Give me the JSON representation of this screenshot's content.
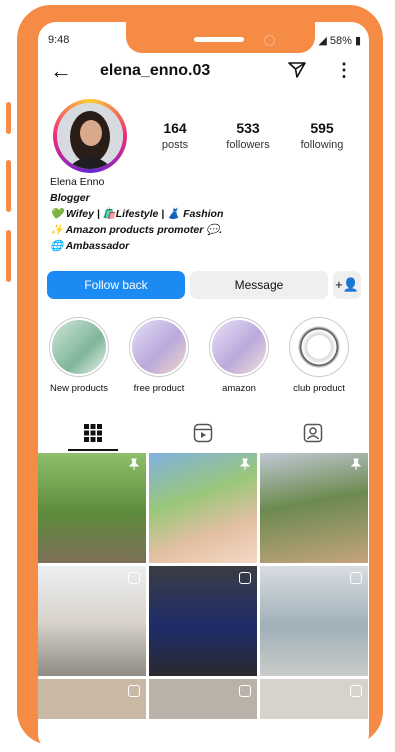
{
  "status_bar": {
    "time": "9:48",
    "battery": "58%"
  },
  "header": {
    "username": "elena_enno.03"
  },
  "profile": {
    "stats": [
      {
        "value": "164",
        "label": "posts"
      },
      {
        "value": "533",
        "label": "followers"
      },
      {
        "value": "595",
        "label": "following"
      }
    ],
    "name": "Elena Enno",
    "category": "Blogger",
    "bio_lines": [
      "💚 Wifey | 🛍️Lifestyle | 👗 Fashion",
      "✨ Amazon products promoter 💬.",
      "🌐 Ambassador"
    ]
  },
  "actions": {
    "follow_back": "Follow back",
    "message": "Message"
  },
  "highlights": [
    {
      "label": "New products"
    },
    {
      "label": "free product"
    },
    {
      "label": "amazon"
    },
    {
      "label": "club product"
    }
  ],
  "colors": {
    "phone_frame": "#f58b45",
    "follow_button": "#1b8af2"
  }
}
